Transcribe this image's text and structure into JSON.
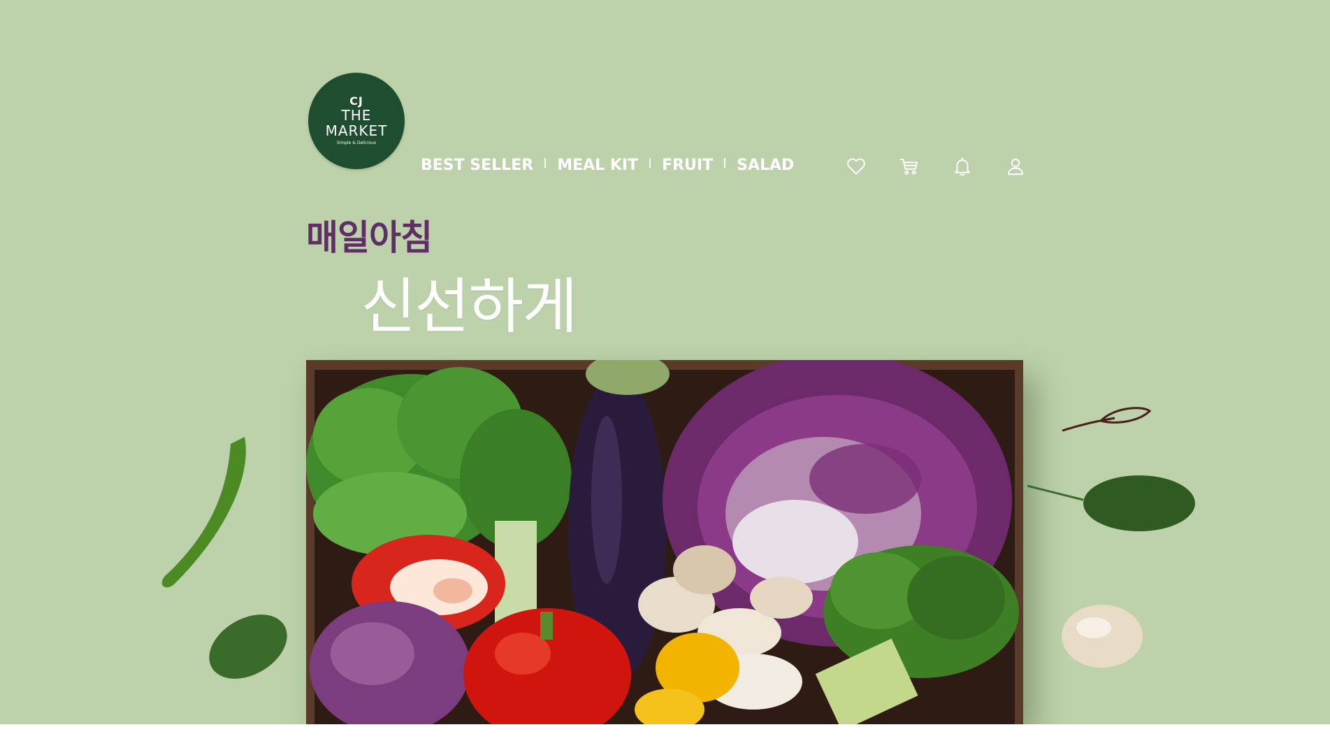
{
  "brand": {
    "logo_line1": "CJ",
    "logo_line2": "THE",
    "logo_line3": "MARKET",
    "logo_tagline": "Simple & Delicious"
  },
  "nav": {
    "items": [
      {
        "label": "BEST SELLER"
      },
      {
        "label": "MEAL KIT"
      },
      {
        "label": "FRUIT"
      },
      {
        "label": "SALAD"
      }
    ]
  },
  "header_icons": [
    "heart-icon",
    "cart-icon",
    "bell-icon",
    "user-icon"
  ],
  "hero": {
    "tagline": "매일아침",
    "headline": "신선하게"
  },
  "colors": {
    "background": "#bdd2aa",
    "logo_bg": "#1e4d30",
    "tagline": "#5e2f63",
    "nav_text": "#ffffff"
  }
}
